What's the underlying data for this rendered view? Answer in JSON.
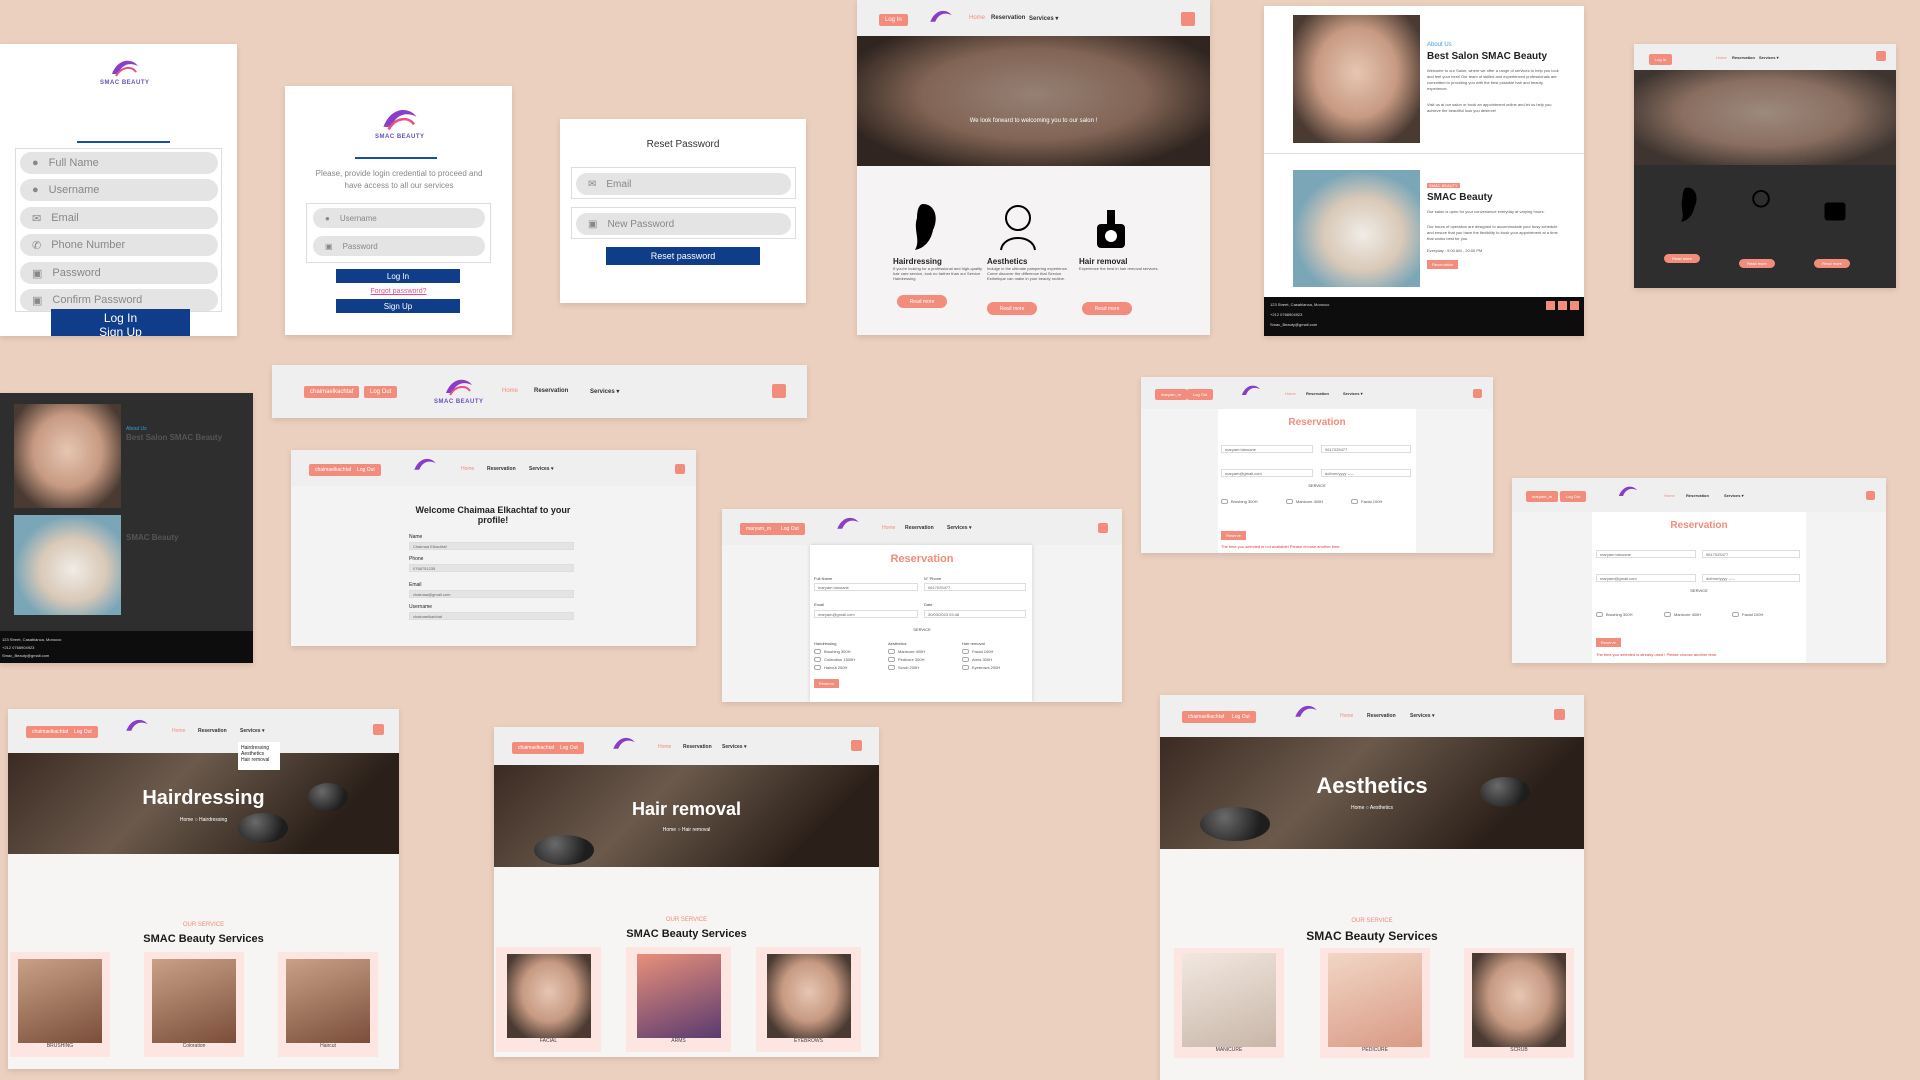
{
  "brand": "SMAC BEAUTY",
  "signup": {
    "fields": [
      "Full Name",
      "Username",
      "Email",
      "Phone Number",
      "Password",
      "Confirm Password"
    ],
    "signup": "Sign Up",
    "login": "Log In"
  },
  "login": {
    "intro": "Please, provide login credential to proceed and have access to all our services",
    "fields": [
      "Username",
      "Password"
    ],
    "login": "Log In",
    "forgot": "Forgot password?",
    "signup": "Sign Up"
  },
  "reset": {
    "title": "Reset Password",
    "fields": [
      "Email",
      "New Password"
    ],
    "button": "Reset password"
  },
  "nav": {
    "login": "Log In",
    "home": "Home",
    "reservation": "Reservation",
    "services": "Services ▾",
    "user1": "chaimaelkachtaf",
    "logout": "Log Out",
    "user2": "maryam_m"
  },
  "home": {
    "hero_text": "We look forward to welcoming you to our salon !",
    "services": [
      {
        "title": "Hairdressing",
        "text": "If you're looking for a professional and high-quality hair care service, look no farther than our Service Hairdressing",
        "btn": "Read more"
      },
      {
        "title": "Aesthetics",
        "text": "Indulge in the ultimate pampering experience. Come discover the difference that Service Esthetique can make in your beauty routine.",
        "btn": "Read more"
      },
      {
        "title": "Hair removal",
        "text": "Experience the best in hair removal services.",
        "btn": "Read more"
      }
    ]
  },
  "about": {
    "label": "About Us",
    "title": "Best Salon SMAC Beauty",
    "p1": "Welcome to our Salon, where we offer a range of services to help you look and feel your best! Our team of skilled and experienced professionals are committed to providing you with the best possible hair and beauty experience.",
    "p2": "Visit us at our salon or book an appointment online and let us help you achieve the beautiful look you deserve!",
    "tag": "SMAC BEAUTY",
    "title2": "SMAC Beauty",
    "p3": "Our salon is open for your convenience everyday at varying hours.",
    "p4": "Our hours of operation are designed to accommodate your busy schedule and ensure that you have the flexibility to book your appointment at a time that works best for you.",
    "hours": "Everyday : 9:00 AM - 20:00 PM",
    "btn": "Reservation"
  },
  "footer": {
    "address": "123 Street, Casablanca, Morocco",
    "phone": "+212 0768904923",
    "email": "Smac_Beauty@gmail.com"
  },
  "profile": {
    "title": "Welcome Chaimaa Elkachtaf to your profile!",
    "fields": [
      {
        "label": "Name",
        "value": "Chaimaa Elkachtaf"
      },
      {
        "label": "Phone",
        "value": "0768751235"
      },
      {
        "label": "Email",
        "value": "chaimaa@gmail.com"
      },
      {
        "label": "Username",
        "value": "chaimaelkachtaf"
      }
    ]
  },
  "reservation": {
    "title": "Reservation",
    "full_name": "Full Name",
    "full_name_val": "maryam latouane",
    "phone": "N° Phone",
    "phone_val": "0617025477",
    "email": "Email",
    "email_val": "maryam@gmail.com",
    "date": "Date",
    "date_val": "30/03/2023 03:48",
    "date_empty": "dd/mm/yyyy --:--",
    "service": "SERVICE",
    "groups": [
      {
        "name": "Hairdressing",
        "items": [
          "Brushing 300H",
          "Coloration 1500H",
          "Haircut 200H"
        ]
      },
      {
        "name": "Aesthetics",
        "items": [
          "Manicure 400H",
          "Pedicure 300H",
          "Scrub 200H"
        ]
      },
      {
        "name": "Hair removal",
        "items": [
          "Facial 100H",
          "Arms 300H",
          "Eyebrows 200H"
        ]
      }
    ],
    "btn": "Reserve",
    "error": "The time you selected is not available! Please choose another time.",
    "error2": "The time you selected is already used ! Please choose another time."
  },
  "pages": {
    "hairdressing": "Hairdressing",
    "hairremoval": "Hair removal",
    "aesthetics": "Aesthetics",
    "home_bc": "Home",
    "our_service": "OUR SERVICE",
    "services_title": "SMAC Beauty Services",
    "dropdown": [
      "Hairdressing",
      "Aesthetics",
      "Hair removal"
    ]
  },
  "captions": {
    "hair": [
      "BRUSHING",
      "Coloration",
      "Haircut"
    ],
    "removal": [
      "FACIAL",
      "ARMS",
      "EYEBROWS"
    ],
    "aesth": [
      "MANICURE",
      "PEDICURE",
      "SCRUB"
    ]
  }
}
